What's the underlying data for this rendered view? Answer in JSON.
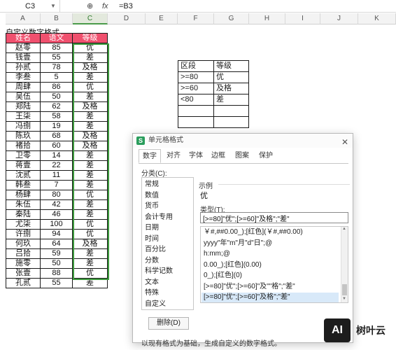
{
  "formula_bar": {
    "name_box": "C3",
    "zoom_icon": "magnify-icon",
    "fx_icon": "fx-icon",
    "formula": "=B3"
  },
  "columns": [
    "A",
    "B",
    "C",
    "D",
    "E",
    "F",
    "G",
    "H",
    "I",
    "J",
    "K"
  ],
  "active_column": "C",
  "sheet": {
    "title": "自定义数字格式",
    "headers": [
      "姓名",
      "语文",
      "等级"
    ],
    "rows": [
      [
        "赵零",
        "85",
        "优"
      ],
      [
        "钱壹",
        "55",
        "差"
      ],
      [
        "孙贰",
        "78",
        "及格"
      ],
      [
        "李叁",
        "5",
        "差"
      ],
      [
        "周肆",
        "86",
        "优"
      ],
      [
        "吴伍",
        "50",
        "差"
      ],
      [
        "郑陆",
        "62",
        "及格"
      ],
      [
        "王柒",
        "58",
        "差"
      ],
      [
        "冯捌",
        "19",
        "差"
      ],
      [
        "陈玖",
        "68",
        "及格"
      ],
      [
        "褚拾",
        "60",
        "及格"
      ],
      [
        "卫零",
        "14",
        "差"
      ],
      [
        "蒋壹",
        "22",
        "差"
      ],
      [
        "沈贰",
        "11",
        "差"
      ],
      [
        "韩叁",
        "7",
        "差"
      ],
      [
        "杨肆",
        "80",
        "优"
      ],
      [
        "朱伍",
        "42",
        "差"
      ],
      [
        "秦陆",
        "46",
        "差"
      ],
      [
        "尤柒",
        "100",
        "优"
      ],
      [
        "许捌",
        "94",
        "优"
      ],
      [
        "何玖",
        "64",
        "及格"
      ],
      [
        "吕拾",
        "59",
        "差"
      ],
      [
        "施零",
        "50",
        "差"
      ],
      [
        "张壹",
        "88",
        "优"
      ],
      [
        "孔贰",
        "55",
        "差"
      ]
    ]
  },
  "lookup_table": {
    "headers": [
      "区段",
      "等级"
    ],
    "rows": [
      [
        ">=80",
        "优"
      ],
      [
        ">=60",
        "及格"
      ],
      [
        "<80",
        "差"
      ],
      [
        "",
        ""
      ],
      [
        "",
        ""
      ]
    ]
  },
  "dialog": {
    "title": "单元格格式",
    "close_icon": "close-icon",
    "tabs": [
      "数字",
      "对齐",
      "字体",
      "边框",
      "图案",
      "保护"
    ],
    "active_tab": "数字",
    "category_label": "分类(C):",
    "categories": [
      "常规",
      "数值",
      "货币",
      "会计专用",
      "日期",
      "时间",
      "百分比",
      "分数",
      "科学记数",
      "文本",
      "特殊",
      "自定义"
    ],
    "sample_label": "示例",
    "sample_value": "优",
    "type_label": "类型(T):",
    "type_value": "[>=80]\"优\";[>=60]\"及格\";\"差\"",
    "type_list": [
      "￥#,##0.00_);[红色](￥#,##0.00)",
      "yyyy\"年\"m\"月\"d\"日\";@",
      "h:mm;@",
      "0.00_);[红色](0.00)",
      "0_);[红色](0)",
      "[>=80]\"优\";[>=60]\"及\"\"格\";\"差\"",
      "[>=80]\"优\";[>=60]\"及格\";\"差\""
    ],
    "selected_type_index": 6,
    "delete_button": "删除(D)",
    "hint": "以现有格式为基础，生成自定义的数字格式。"
  },
  "watermark": {
    "logo": "AI",
    "text": "树叶云"
  }
}
